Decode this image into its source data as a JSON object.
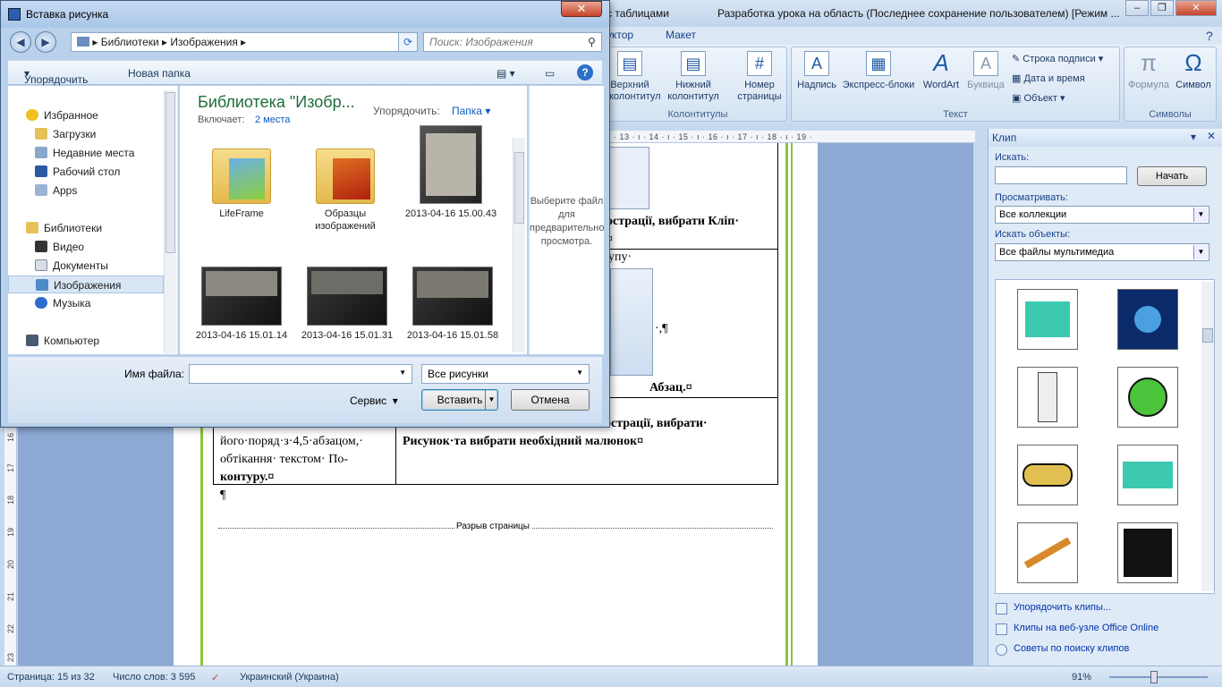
{
  "word": {
    "title_tab": "с таблицами",
    "title": "Разработка урока на область (Последнее сохранение пользователем) [Режим ...",
    "tabs": [
      "Конструктор",
      "Макет"
    ],
    "tab_partial": "уктор",
    "ribbon": {
      "header_footer_group": "Колонтитулы",
      "header_btn": "Верхний колонтитул",
      "footer_btn": "Нижний колонтитул",
      "pagenum_btn": "Номер страницы",
      "text_group": "Текст",
      "textbox_btn": "Надпись",
      "quickparts_btn": "Экспресс-блоки",
      "wordart_btn": "WordArt",
      "dropcap_btn": "Буквица",
      "signature_line": "Строка подписи",
      "datetime": "Дата и время",
      "object": "Объект",
      "symbols_group": "Символы",
      "formula_btn": "Формула",
      "symbol_btn": "Символ"
    },
    "ruler": "· 13 · ı · 14 · ı · 15 · ı · 16 · ı · 17 · ı · 18 · ı · 19 ·",
    "vruler": [
      "16",
      "17",
      "18",
      "19",
      "20",
      "21",
      "22",
      "23"
    ],
    "doc": {
      "line1": "острації, вибрати Кліп·",
      "line1b": "¤",
      "line2": "упу·",
      "line3": "·,¶",
      "line4": "Абзац.¤",
      "line5": "острації, вибрати·",
      "line6": "Рисунок·та вибрати необхідний малюнок¤",
      "cell_a": "його·поряд·з·4,5·абзацом,·",
      "cell_b": "обтікання·  текстом·  По-",
      "cell_c": "контуру.¤",
      "para": "¶",
      "pagebreak": "Разрыв страницы"
    }
  },
  "clip": {
    "title": "Клип",
    "search_label": "Искать:",
    "search_value": "",
    "go_btn": "Начать",
    "browse_label": "Просматривать:",
    "browse_value": "Все коллекции",
    "objects_label": "Искать объекты:",
    "objects_value": "Все файлы мультимедиа",
    "links": [
      "Упорядочить клипы...",
      "Клипы на веб-узле Office Online",
      "Советы по поиску клипов"
    ]
  },
  "status": {
    "page": "Страница: 15 из 32",
    "words": "Число слов: 3 595",
    "lang": "Украинский (Украина)",
    "zoom": "91%"
  },
  "dialog": {
    "title": "Вставка рисунка",
    "close": "✕",
    "breadcrumb": [
      "Библиотеки",
      "Изображения"
    ],
    "search_placeholder": "Поиск: Изображения",
    "organize": "Упорядочить",
    "new_folder": "Новая папка",
    "nav": {
      "favorites": "Избранное",
      "downloads": "Загрузки",
      "recent": "Недавние места",
      "desktop": "Рабочий стол",
      "apps": "Apps",
      "libraries": "Библиотеки",
      "video": "Видео",
      "documents": "Документы",
      "pictures": "Изображения",
      "music": "Музыка",
      "computer": "Компьютер"
    },
    "library_title": "Библиотека \"Изобр...",
    "includes_label": "Включает:",
    "includes_value": "2 места",
    "arrange_label": "Упорядочить:",
    "arrange_value": "Папка",
    "files": [
      {
        "name": "LifeFrame",
        "kind": "folder"
      },
      {
        "name": "Образцы изображений",
        "kind": "folder"
      },
      {
        "name": "2013-04-16 15.00.43",
        "kind": "photo"
      },
      {
        "name": "2013-04-16 15.01.14",
        "kind": "photo2"
      },
      {
        "name": "2013-04-16 15.01.31",
        "kind": "photo2"
      },
      {
        "name": "2013-04-16 15.01.58",
        "kind": "photo2"
      }
    ],
    "preview_text": "Выберите файл для предварительно просмотра.",
    "filename_label": "Имя файла:",
    "filename_value": "",
    "filetype_value": "Все рисунки",
    "service": "Сервис",
    "insert_btn": "Вставить",
    "cancel_btn": "Отмена"
  }
}
